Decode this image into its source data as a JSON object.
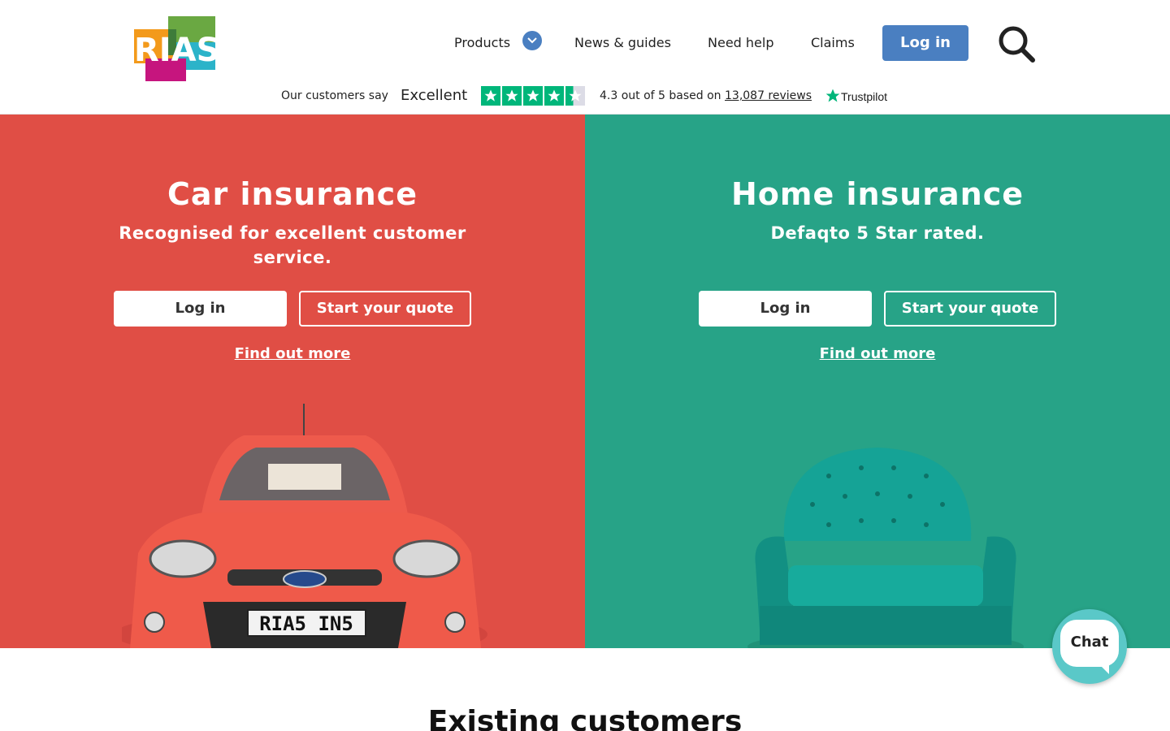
{
  "brand": {
    "logo_text": "RIAS"
  },
  "nav": {
    "products": "Products",
    "news": "News & guides",
    "help": "Need help",
    "claims": "Claims",
    "login": "Log in"
  },
  "trustpilot": {
    "prefix": "Our customers say",
    "rating_word": "Excellent",
    "score_text": "4.3 out of 5 based on",
    "reviews_link": "13,087 reviews",
    "brand": "Trustpilot",
    "stars": 4.3
  },
  "panels": [
    {
      "title": "Car insurance",
      "subtitle": "Recognised for excellent customer service.",
      "login": "Log in",
      "quote": "Start your quote",
      "more": "Find out more",
      "color": "#e04e45"
    },
    {
      "title": "Home insurance",
      "subtitle": "Defaqto 5 Star rated.",
      "login": "Log in",
      "quote": "Start your quote",
      "more": "Find out more",
      "color": "#27a387"
    }
  ],
  "car": {
    "plate": "RIA5 IN5"
  },
  "chat": {
    "label": "Chat"
  },
  "section": {
    "existing_title": "Existing customers"
  },
  "colors": {
    "accent": "#4a7fc1",
    "trustpilot": "#00b67a"
  }
}
